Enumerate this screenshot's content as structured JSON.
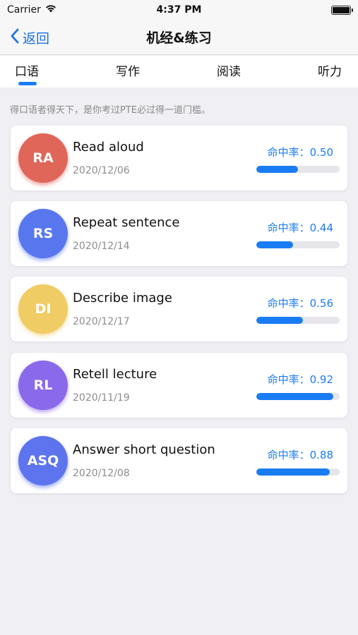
{
  "status_bar": {
    "carrier": "Carrier",
    "time": "4:37 PM"
  },
  "nav": {
    "back_label": "返回",
    "title": "机经&练习"
  },
  "tabs": [
    {
      "label": "口语",
      "active": true
    },
    {
      "label": "写作",
      "active": false
    },
    {
      "label": "阅读",
      "active": false
    },
    {
      "label": "听力",
      "active": false
    }
  ],
  "subtitle": "得口语者得天下，是你考过PTE必过得一道门槛。",
  "items": [
    {
      "abbr": "RA",
      "title": "Read aloud",
      "date": "2020/12/06",
      "rate_label": "命中率：0.50",
      "rate": 0.5,
      "color": "#e0665a"
    },
    {
      "abbr": "RS",
      "title": "Repeat sentence",
      "date": "2020/12/14",
      "rate_label": "命中率：0.44",
      "rate": 0.44,
      "color": "#5877ef"
    },
    {
      "abbr": "DI",
      "title": "Describe image",
      "date": "2020/12/17",
      "rate_label": "命中率：0.56",
      "rate": 0.56,
      "color": "#efcc64"
    },
    {
      "abbr": "RL",
      "title": "Retell lecture",
      "date": "2020/11/19",
      "rate_label": "命中率：0.92",
      "rate": 0.92,
      "color": "#8a69ea"
    },
    {
      "abbr": "ASQ",
      "title": "Answer short question",
      "date": "2020/12/08",
      "rate_label": "命中率：0.88",
      "rate": 0.88,
      "color": "#5d74ee"
    }
  ],
  "colors": {
    "accent": "#1a7cf5",
    "background": "#efeff4"
  }
}
